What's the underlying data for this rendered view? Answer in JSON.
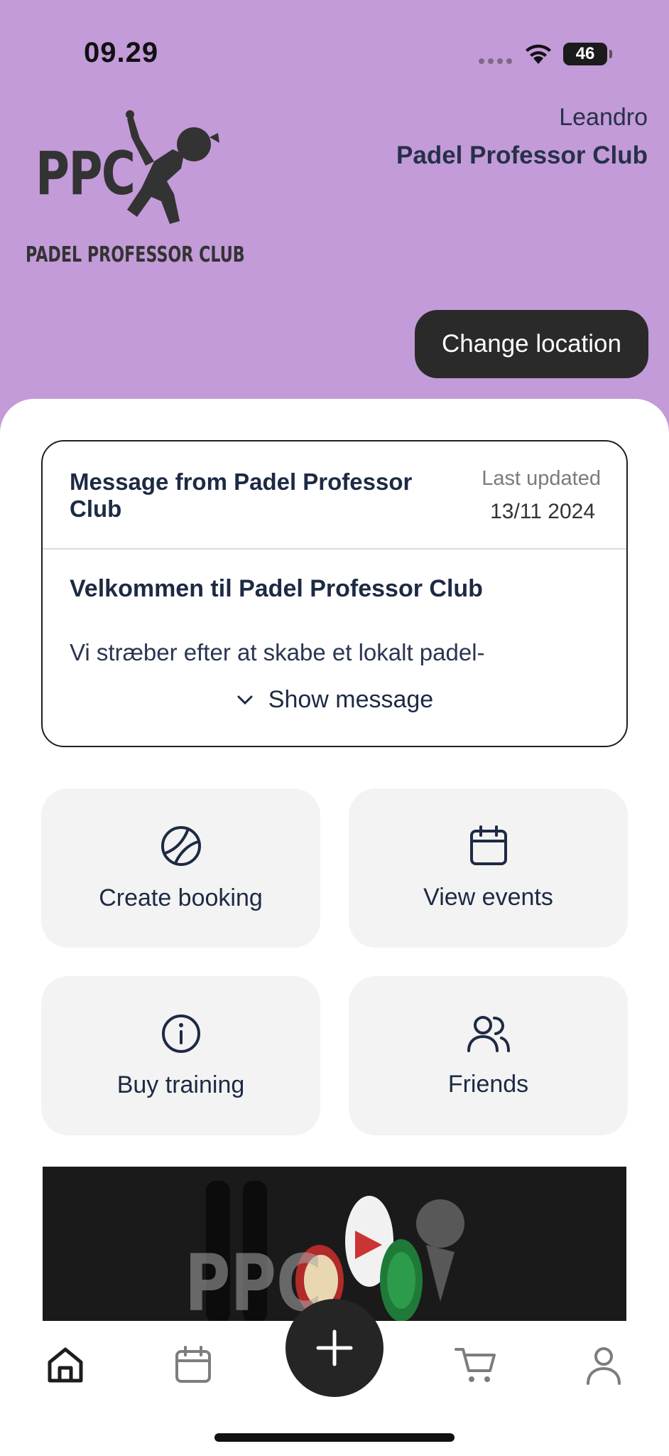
{
  "status_bar": {
    "time": "09.29",
    "battery": "46"
  },
  "header": {
    "logo_letters": "PPC",
    "logo_subtitle": "PADEL PROFESSOR CLUB",
    "user_name": "Leandro",
    "club_name": "Padel Professor Club",
    "change_location_label": "Change location"
  },
  "message": {
    "title": "Message from Padel Professor Club",
    "last_updated_label": "Last updated",
    "last_updated_date": "13/11 2024",
    "heading": "Velkommen til Padel Professor Club",
    "preview": "Vi stræber efter at skabe et lokalt padel-",
    "show_label": "Show message"
  },
  "actions": [
    {
      "label": "Create booking",
      "icon": "tennis-ball-icon"
    },
    {
      "label": "View events",
      "icon": "calendar-icon"
    },
    {
      "label": "Buy training",
      "icon": "info-icon"
    },
    {
      "label": "Friends",
      "icon": "users-icon"
    }
  ],
  "banner": {
    "text": "PPC"
  },
  "tab_bar": {
    "items": [
      {
        "icon": "home-icon",
        "active": true
      },
      {
        "icon": "calendar-icon",
        "active": false
      },
      {
        "icon": "plus-icon",
        "active": false
      },
      {
        "icon": "cart-icon",
        "active": false
      },
      {
        "icon": "profile-icon",
        "active": false
      }
    ]
  },
  "colors": {
    "header_bg": "#c39bd8",
    "dark": "#2b2a2a",
    "text": "#1d2a44",
    "tile_bg": "#f3f3f3"
  }
}
